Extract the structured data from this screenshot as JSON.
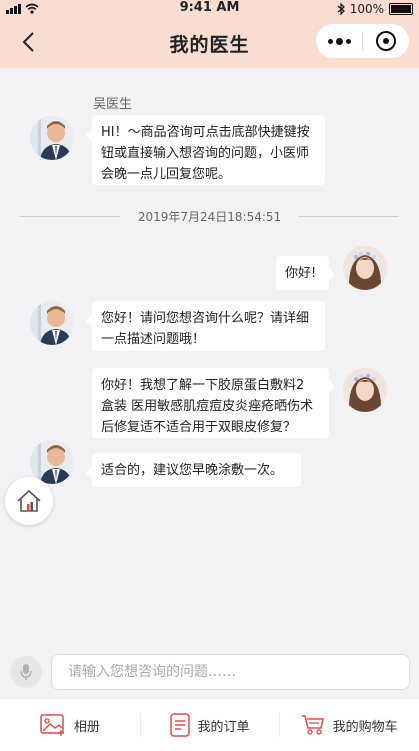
{
  "status_bar": {
    "time": "9:41 AM",
    "battery": "100%"
  },
  "header": {
    "title": "我的医生"
  },
  "colors": {
    "accent": "#e24a4a",
    "header_bg": "#f8ddd0",
    "chat_bg": "#f2f2f4"
  },
  "messages": [
    {
      "from": "doctor",
      "name": "吴医生",
      "lines": [
        "HI！～商品咨询可点击底部快捷键按",
        "钮或直接输入想咨询的问题，小医师",
        "会晚一点儿回复您呢。"
      ]
    },
    {
      "from": "patient",
      "lines": [
        "你好!"
      ]
    },
    {
      "from": "doctor",
      "lines": [
        "您好！请问您想咨询什么呢？请详细",
        "一点描述问题哦！"
      ]
    },
    {
      "from": "patient",
      "lines": [
        "你好！我想了解一下胶原蛋白敷料2",
        "盒装 医用敏感肌痘痘皮炎痤疮晒伤术",
        "后修复适不适合用于双眼皮修复？"
      ]
    },
    {
      "from": "doctor",
      "lines": [
        "适合的，建议您早晚涂敷一次。"
      ]
    }
  ],
  "time_separator": "2019年7月24日18:54:51",
  "input": {
    "placeholder": "请输入您想咨询的问题……"
  },
  "tabs": [
    {
      "label": "相册",
      "icon": "album-icon"
    },
    {
      "label": "我的订单",
      "icon": "order-icon"
    },
    {
      "label": "我的购物车",
      "icon": "cart-icon"
    }
  ]
}
